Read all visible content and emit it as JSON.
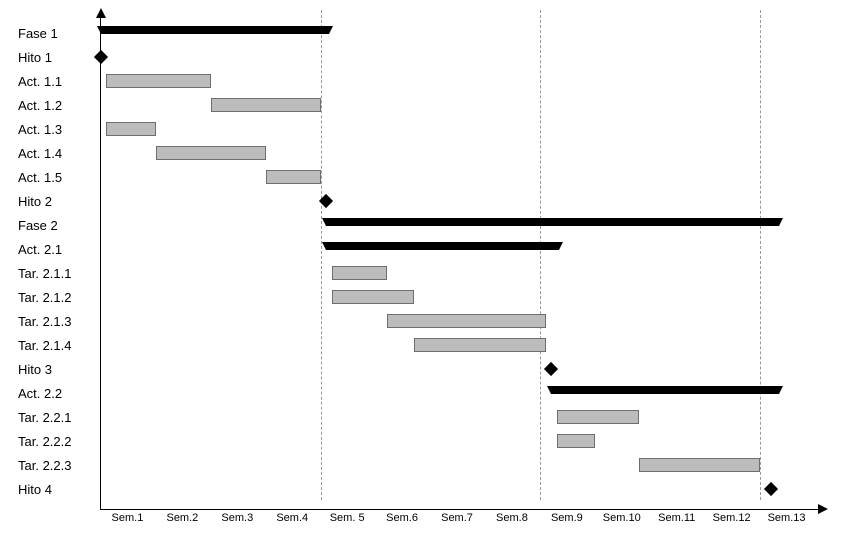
{
  "chart_data": {
    "type": "bar",
    "title": "",
    "xlabel": "",
    "ylabel": "",
    "xlim": [
      0,
      13
    ],
    "time_unit": "weeks",
    "categories": [
      "Sem.1",
      "Sem.2",
      "Sem.3",
      "Sem.4",
      "Sem. 5",
      "Sem.6",
      "Sem.7",
      "Sem.8",
      "Sem.9",
      "Sem.10",
      "Sem.11",
      "Sem.12",
      "Sem.13"
    ],
    "gridlines_at": [
      4,
      8,
      12
    ],
    "rows": [
      {
        "label": "Fase 1",
        "type": "summary",
        "start": 0.0,
        "end": 4.0
      },
      {
        "label": "Hito 1",
        "type": "milestone",
        "at": 0.0
      },
      {
        "label": "Act. 1.1",
        "type": "task",
        "start": 0.1,
        "end": 2.0
      },
      {
        "label": "Act. 1.2",
        "type": "task",
        "start": 2.0,
        "end": 4.0
      },
      {
        "label": "Act. 1.3",
        "type": "task",
        "start": 0.1,
        "end": 1.0
      },
      {
        "label": "Act. 1.4",
        "type": "task",
        "start": 1.0,
        "end": 3.0
      },
      {
        "label": "Act. 1.5",
        "type": "task",
        "start": 3.0,
        "end": 4.0
      },
      {
        "label": "Hito 2",
        "type": "milestone",
        "at": 4.1
      },
      {
        "label": "Fase 2",
        "type": "summary",
        "start": 4.1,
        "end": 12.2
      },
      {
        "label": "Act.  2.1",
        "type": "summary",
        "start": 4.1,
        "end": 8.2
      },
      {
        "label": "Tar. 2.1.1",
        "type": "task",
        "start": 4.2,
        "end": 5.2
      },
      {
        "label": "Tar. 2.1.2",
        "type": "task",
        "start": 4.2,
        "end": 5.7
      },
      {
        "label": "Tar. 2.1.3",
        "type": "task",
        "start": 5.2,
        "end": 8.1
      },
      {
        "label": "Tar. 2.1.4",
        "type": "task",
        "start": 5.7,
        "end": 8.1
      },
      {
        "label": "Hito 3",
        "type": "milestone",
        "at": 8.2
      },
      {
        "label": "Act. 2.2",
        "type": "summary",
        "start": 8.2,
        "end": 12.2
      },
      {
        "label": "Tar. 2.2.1",
        "type": "task",
        "start": 8.3,
        "end": 9.8
      },
      {
        "label": "Tar. 2.2.2",
        "type": "task",
        "start": 8.3,
        "end": 9.0
      },
      {
        "label": "Tar. 2.2.3",
        "type": "task",
        "start": 9.8,
        "end": 12.0
      },
      {
        "label": "Hito 4",
        "type": "milestone",
        "at": 12.2
      }
    ]
  }
}
